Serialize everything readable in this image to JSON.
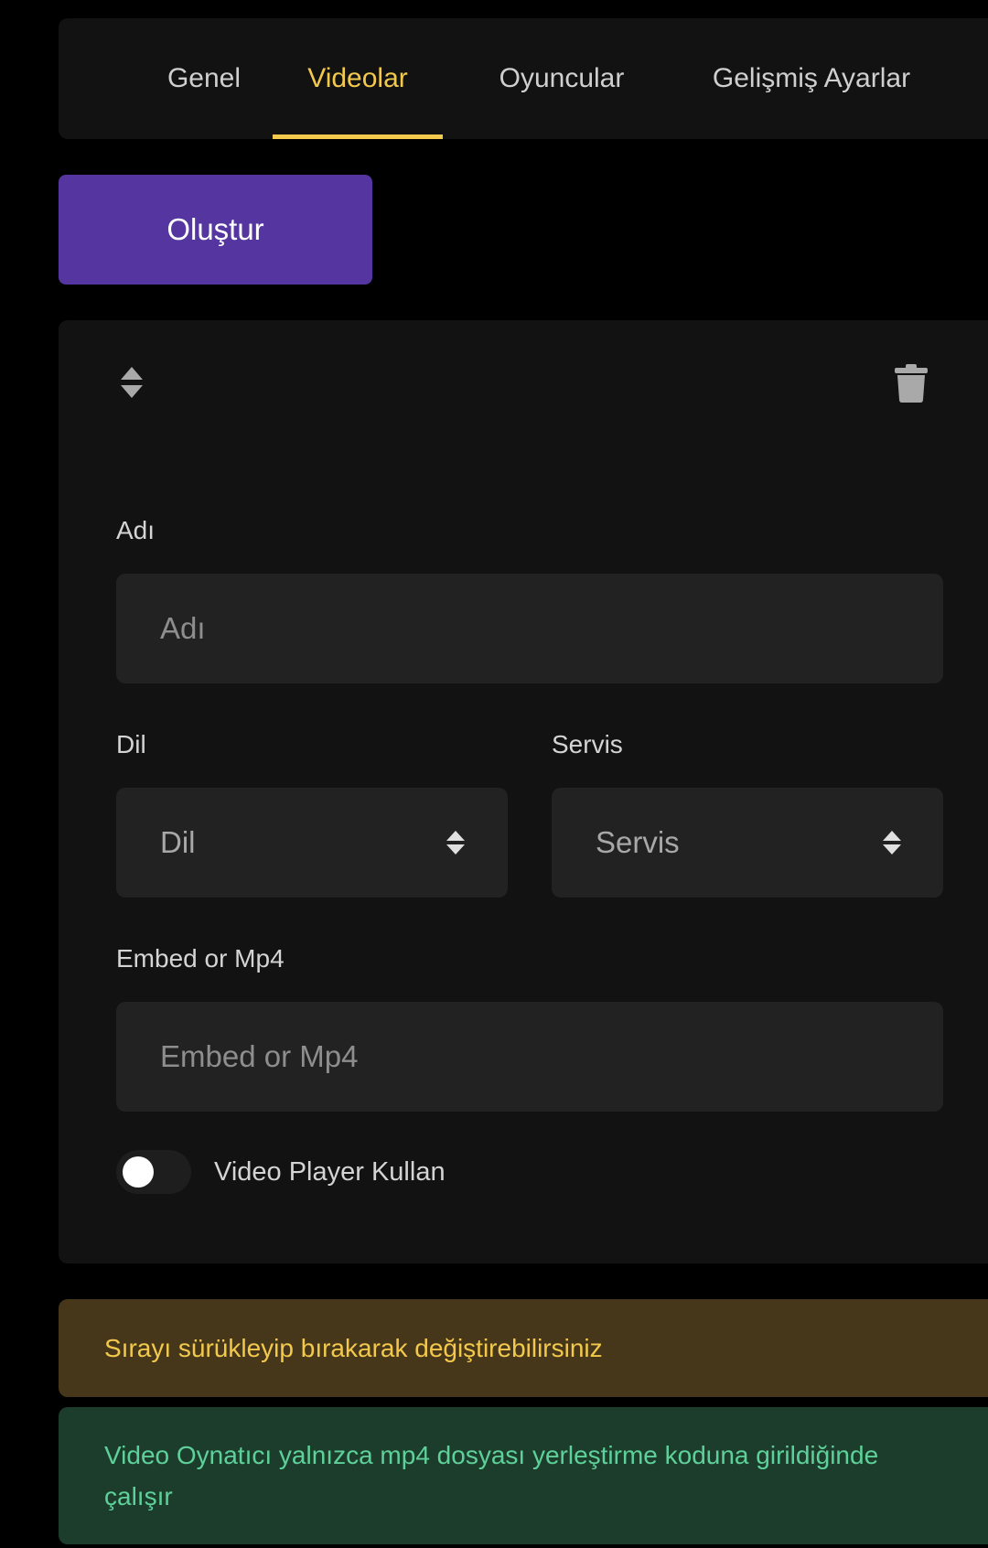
{
  "tabs": [
    {
      "label": "Genel",
      "active": false
    },
    {
      "label": "Videolar",
      "active": true
    },
    {
      "label": "Oyuncular",
      "active": false
    },
    {
      "label": "Gelişmiş Ayarlar",
      "active": false
    }
  ],
  "create_button": {
    "label": "Oluştur"
  },
  "video_item": {
    "drag_icon": "sort-icon",
    "delete_icon": "trash-icon",
    "name": {
      "label": "Adı",
      "placeholder": "Adı",
      "value": ""
    },
    "language": {
      "label": "Dil",
      "selected": "Dil"
    },
    "service": {
      "label": "Servis",
      "selected": "Servis"
    },
    "embed": {
      "label": "Embed or Mp4",
      "placeholder": "Embed or Mp4",
      "value": ""
    },
    "video_player_toggle": {
      "label": "Video Player Kullan",
      "on": false
    }
  },
  "alerts": {
    "warning": "Sırayı sürükleyip bırakarak değiştirebilirsiniz",
    "info": "Video Oynatıcı yalnızca mp4 dosyası yerleştirme koduna girildiğinde çalışır"
  },
  "colors": {
    "accent": "#f2c94c",
    "primary_button": "#5535a0",
    "warning_bg": "#47371a",
    "info_bg": "#1d3d2c",
    "info_text": "#5ed19a"
  }
}
